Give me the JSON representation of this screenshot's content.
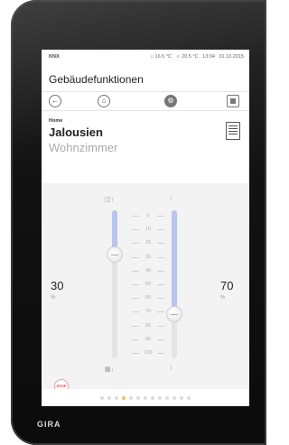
{
  "brand": "GIRA",
  "status": {
    "protocol": "KNX",
    "indoor_temp": "16.5 °C",
    "outdoor_temp": "20.5 °C",
    "time": "13:04",
    "date": "01.10.2015"
  },
  "app": {
    "title": "Gebäudefunktionen"
  },
  "nav": {
    "back_icon": "back-arrow-icon",
    "home_icon": "home-icon",
    "settings_icon": "gear-icon",
    "grid_icon": "grid-icon"
  },
  "device": {
    "breadcrumb": "Home",
    "name": "Jalousien",
    "room": "Wohnzimmer",
    "tile_icon": "blind-tile-icon"
  },
  "control": {
    "left_value": "30",
    "left_unit": "%",
    "right_value": "70",
    "right_unit": "%",
    "left_slider_percent": 30,
    "right_slider_percent": 70,
    "scale": [
      "0",
      "10",
      "20",
      "30",
      "40",
      "50",
      "60",
      "70",
      "80",
      "90",
      "100"
    ],
    "stop_label": "STOP",
    "up_icon": "blind-up-icon",
    "down_icon": "blind-down-icon",
    "slat_icon": "slat-angle-icon"
  },
  "pager": {
    "pages": 13,
    "active": 3
  },
  "colors": {
    "accent": "#b9c4ea",
    "stop": "#d33333",
    "pager_active": "#f0c46a"
  }
}
